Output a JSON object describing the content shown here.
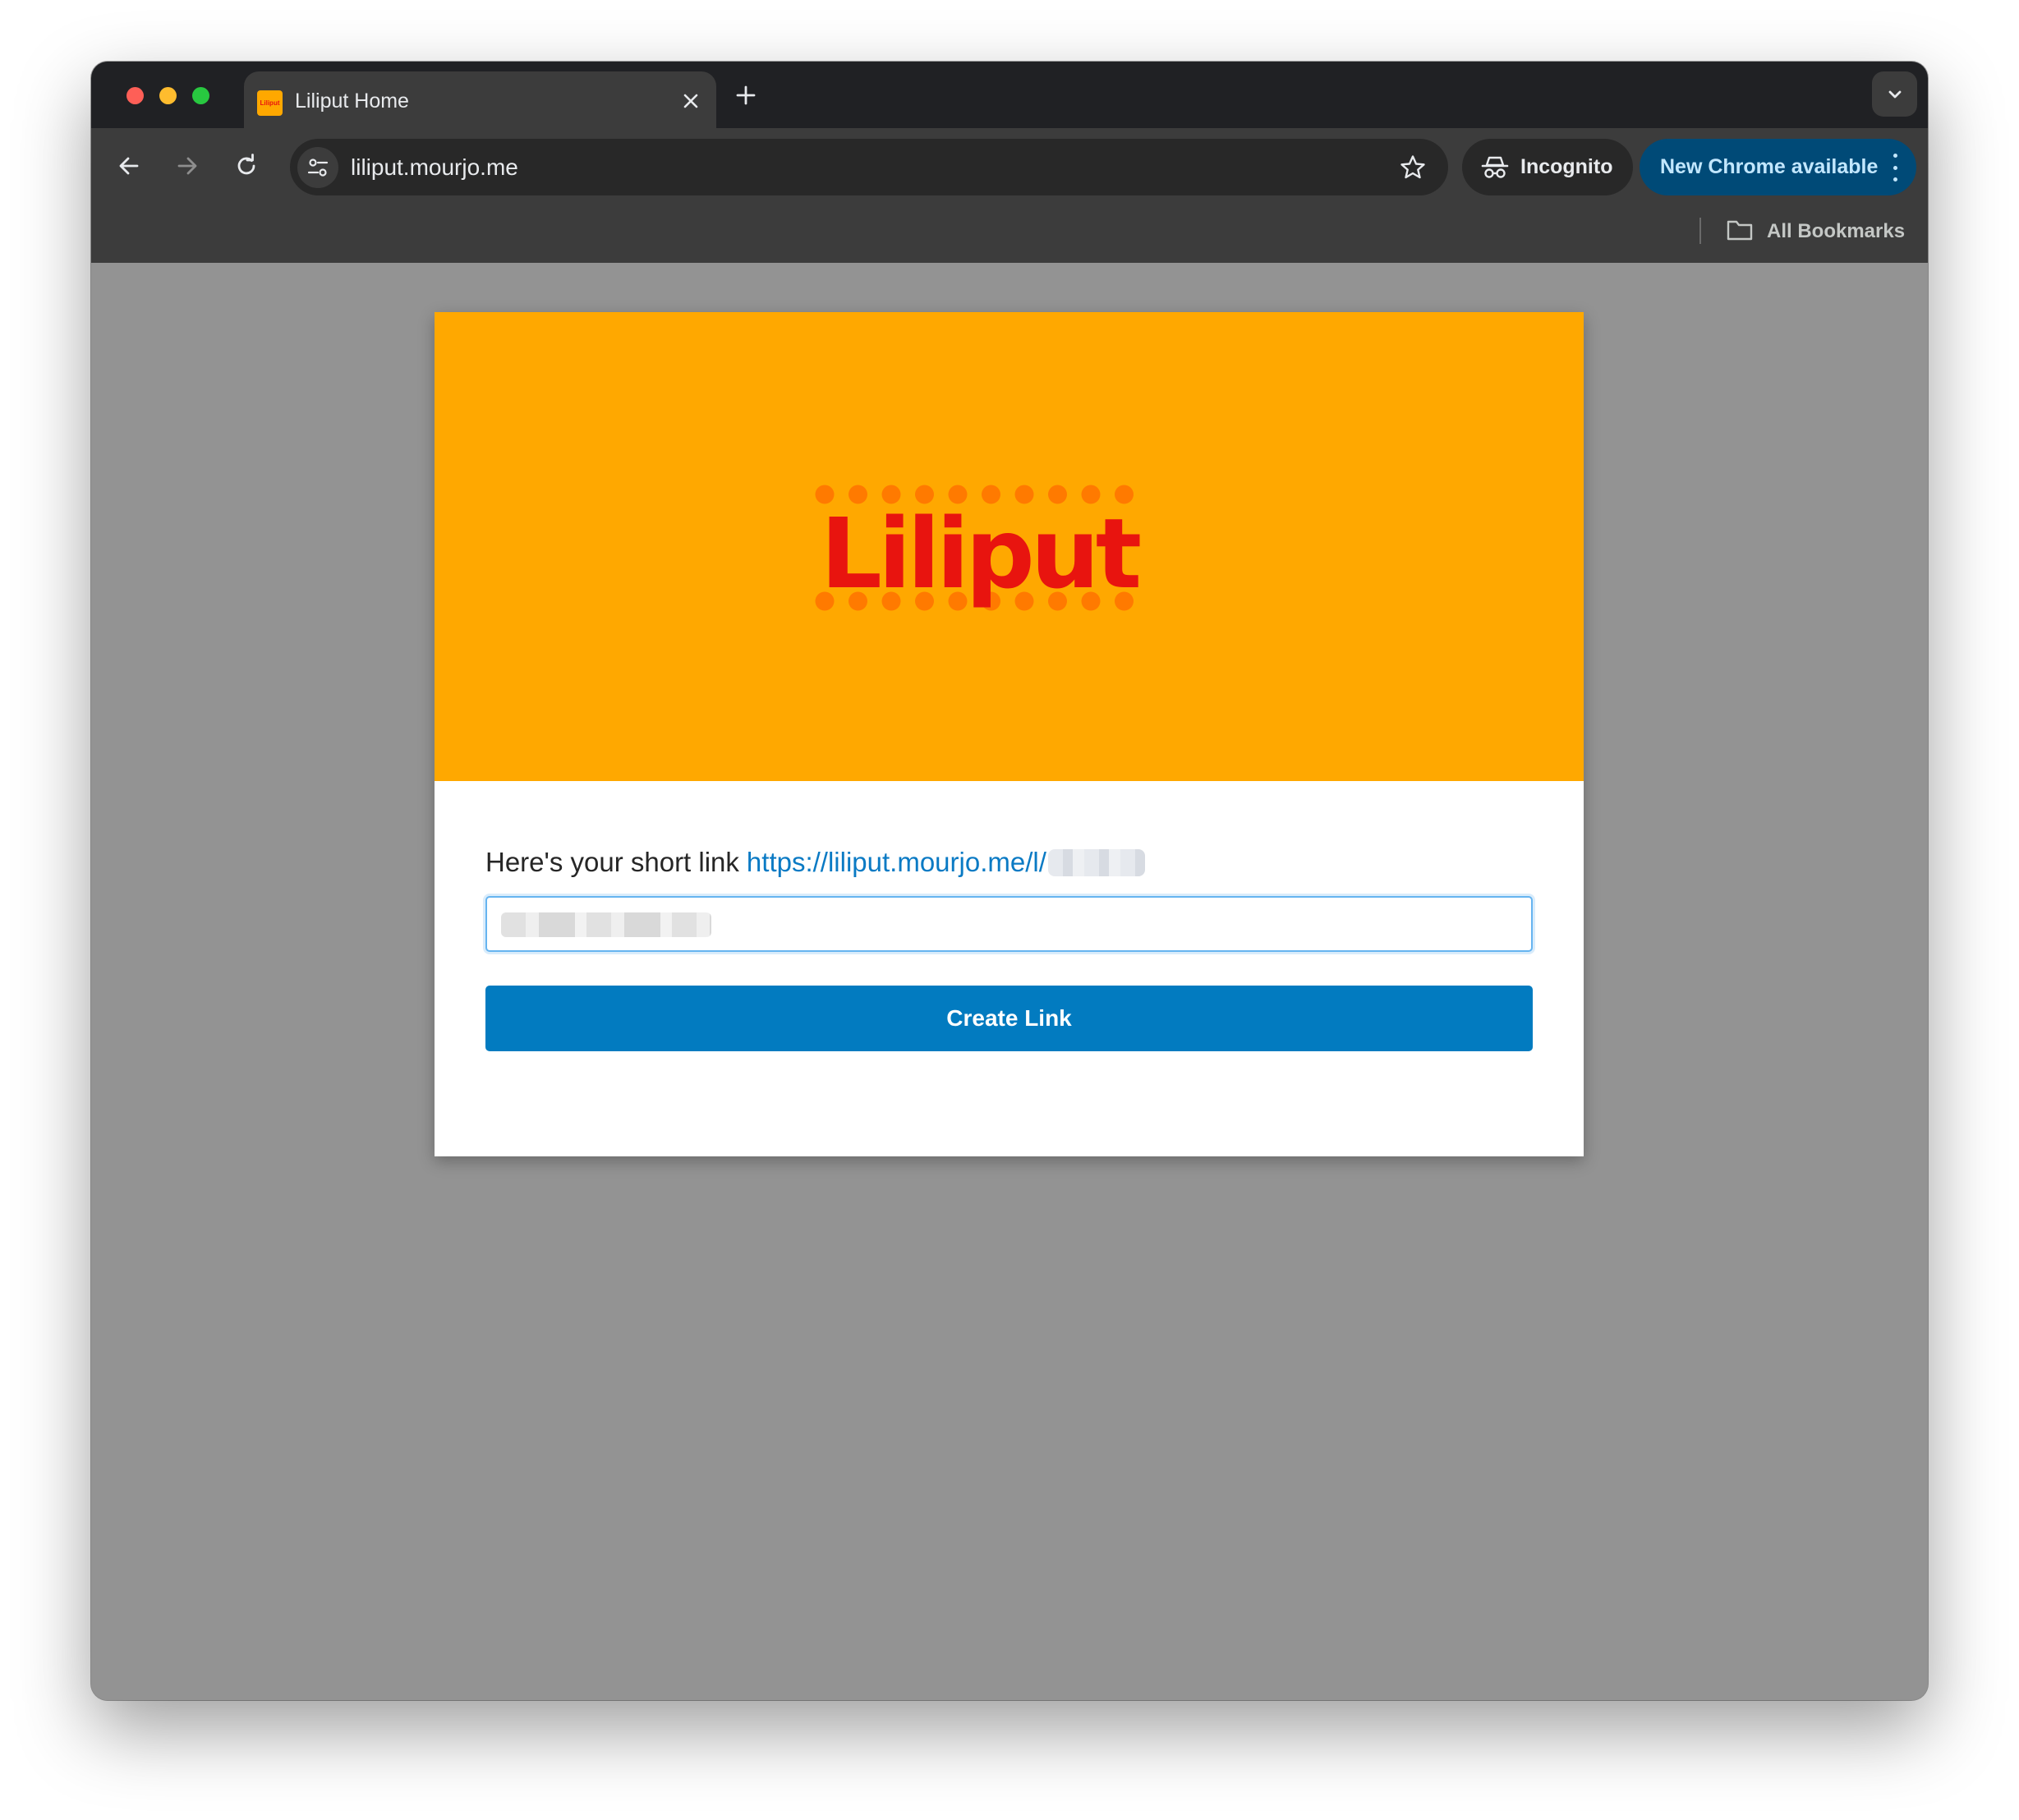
{
  "window": {
    "tab": {
      "title": "Liliput Home",
      "favicon_text": "Liliput"
    },
    "icons": {
      "close_tab": "close-icon",
      "new_tab": "plus-icon",
      "tab_search": "chevron-down-icon",
      "back": "arrow-left-icon",
      "forward": "arrow-right-icon",
      "reload": "reload-icon",
      "site_info": "tune-icon",
      "bookmark": "star-icon",
      "incognito": "incognito-icon",
      "menu": "vertical-dots-icon",
      "folder": "folder-icon"
    },
    "toolbar": {
      "url": "liliput.mourjo.me",
      "incognito_label": "Incognito",
      "update_label": "New Chrome available"
    },
    "bookmarks": {
      "all_bookmarks_label": "All Bookmarks"
    }
  },
  "page": {
    "logo_text": "Liliput",
    "shortlink_prefix": "Here's your short link",
    "shortlink_url": "https://liliput.mourjo.me/l/",
    "input_value": "",
    "button_label": "Create Link"
  },
  "colors": {
    "hero_background": "#ffa800",
    "logo_text": "#e8140f",
    "logo_dots": "#ff7a00",
    "link": "#0a7ac4",
    "button": "#027bc0",
    "update_chip": "#004a77"
  }
}
